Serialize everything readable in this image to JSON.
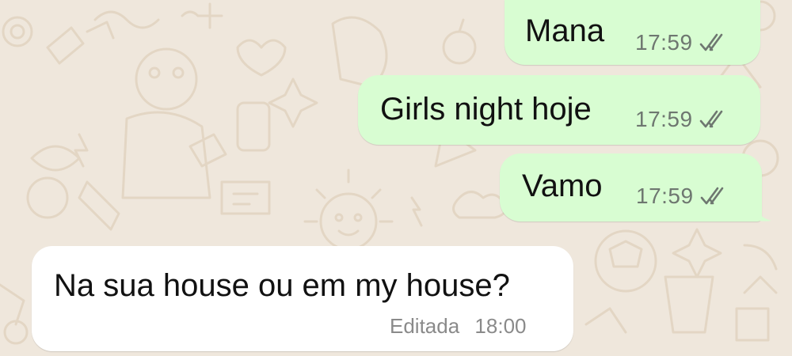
{
  "colors": {
    "wallpaper": "#efe7dc",
    "outgoing_bubble": "#d8fdd2",
    "incoming_bubble": "#ffffff",
    "tick_color": "#6e7770"
  },
  "messages": [
    {
      "direction": "outgoing",
      "text": "Mana",
      "time": "17:59",
      "status_icon": "double-check-icon"
    },
    {
      "direction": "outgoing",
      "text": "Girls night hoje",
      "time": "17:59",
      "status_icon": "double-check-icon"
    },
    {
      "direction": "outgoing",
      "text": "Vamo",
      "time": "17:59",
      "status_icon": "double-check-icon"
    },
    {
      "direction": "incoming",
      "text": "Na sua house ou em my house?",
      "edited_label": "Editada",
      "time": "18:00"
    }
  ]
}
